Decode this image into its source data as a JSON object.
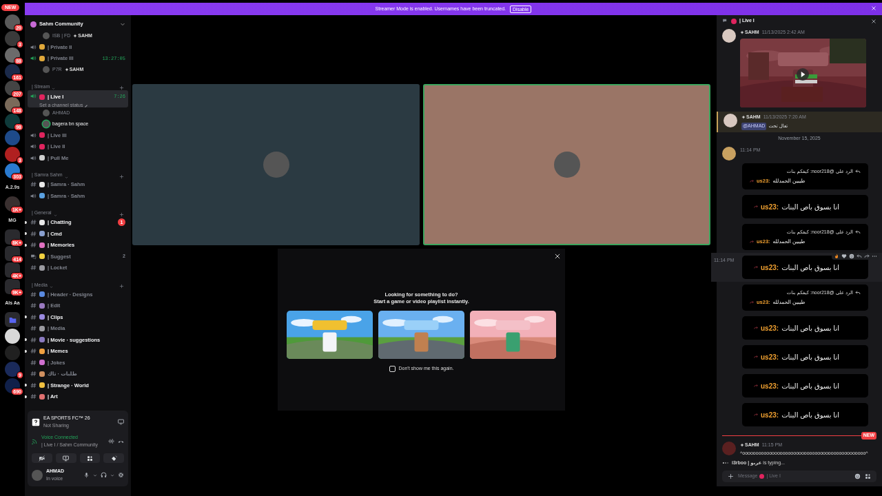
{
  "rail": {
    "new_badge": "NEW",
    "servers": [
      {
        "kind": "avatar",
        "color": "#5a5a5a",
        "badge": "20"
      },
      {
        "kind": "avatar",
        "color": "#3a3a3a",
        "badge": "3"
      },
      {
        "kind": "avatar",
        "color": "#6b6b6b",
        "badge": "88"
      },
      {
        "kind": "avatar",
        "color": "#1b2a4a",
        "badge": "161"
      },
      {
        "kind": "avatar",
        "color": "#444444",
        "badge": "207"
      },
      {
        "kind": "avatar",
        "color": "#7a6a5a",
        "badge": "148"
      },
      {
        "kind": "avatar",
        "color": "#0f3a3a",
        "badge": "98"
      },
      {
        "kind": "avatar",
        "color": "#1e4a8a"
      },
      {
        "kind": "avatar",
        "color": "#b02020",
        "badge": "3"
      },
      {
        "kind": "avatar",
        "color": "#2a7ad0",
        "badge": "303"
      },
      {
        "kind": "text",
        "label": "A.2.9s"
      },
      {
        "kind": "avatar",
        "color": "#3a3030",
        "badge": "1K+"
      },
      {
        "kind": "text",
        "label": "MG"
      },
      {
        "kind": "folder",
        "color": "#2a2a2e",
        "badge": "8K+"
      },
      {
        "kind": "folder",
        "color": "#2a2a2e",
        "badge": "414"
      },
      {
        "kind": "folder",
        "color": "#2a2a2e",
        "badge": "4K+"
      },
      {
        "kind": "folder",
        "color": "#2a2a2e",
        "badge": "9K+"
      },
      {
        "kind": "text",
        "label": "Als Aa"
      },
      {
        "kind": "open_folder",
        "color": "#5865f2"
      },
      {
        "kind": "avatar",
        "color": "#d8d8d8"
      },
      {
        "kind": "avatar",
        "color": "#202020"
      },
      {
        "kind": "avatar",
        "color": "#1a2a5a",
        "badge": "9"
      },
      {
        "kind": "avatar",
        "color": "#10204a",
        "badge": "690"
      }
    ]
  },
  "banner": {
    "text": "Streamer Mode is enabled. Usernames have been truncated.",
    "button": "Disable"
  },
  "server": {
    "name": "Sahm Community"
  },
  "channels": [
    {
      "kind": "member",
      "name": "ISB | FD",
      "tag": "SAHM",
      "speaking": false
    },
    {
      "kind": "voice",
      "name": "| Private II",
      "color": "#e0a83a",
      "active": false,
      "selected": false
    },
    {
      "kind": "voice",
      "name": "| Private III",
      "color": "#e0a83a",
      "active": true,
      "timer": "13:27:05",
      "selected": false
    },
    {
      "kind": "member",
      "name": "P7R",
      "tag": "SAHM",
      "speaking": false
    },
    {
      "kind": "category",
      "name": "| Stream"
    },
    {
      "kind": "voice",
      "name": "| Live I",
      "color": "#e0245e",
      "active": true,
      "timer": "7:26",
      "status": "Set a channel status",
      "selected": true
    },
    {
      "kind": "member",
      "name": "AHMAD",
      "speaking": false
    },
    {
      "kind": "member",
      "name": "bagera bn space",
      "speaking": true
    },
    {
      "kind": "voice",
      "name": "| Live III",
      "color": "#e0245e",
      "active": false,
      "selected": false
    },
    {
      "kind": "voice",
      "name": "| Live II",
      "color": "#e0245e",
      "active": false,
      "selected": false
    },
    {
      "kind": "voice",
      "name": "| Pull Me",
      "color": "#cfcfcf",
      "active": false,
      "selected": false
    },
    {
      "kind": "category",
      "name": "| Samra Sahm"
    },
    {
      "kind": "text",
      "name": "| Samra · Sahm",
      "color": "#e8e8e8",
      "unread": false
    },
    {
      "kind": "voice",
      "name": "| Samra · Sahm",
      "color": "#5aa0e0",
      "active": false,
      "selected": false
    },
    {
      "kind": "category",
      "name": "| General"
    },
    {
      "kind": "text",
      "name": "| Chatting",
      "color": "#e8e8e8",
      "unread": true,
      "mentions": "1"
    },
    {
      "kind": "text",
      "name": "| Cmd",
      "color": "#8aa0d0",
      "unread": true
    },
    {
      "kind": "text",
      "name": "| Memories",
      "color": "#e070c0",
      "unread": true
    },
    {
      "kind": "forum",
      "name": "| Suggest",
      "color": "#f0d040",
      "unread": false,
      "count": "2"
    },
    {
      "kind": "text",
      "name": "| Locket",
      "color": "#9a9aa0",
      "unread": false
    },
    {
      "kind": "category",
      "name": "| Media"
    },
    {
      "kind": "text",
      "name": "| Header · Designs",
      "color": "#5a8ae0",
      "unread": false
    },
    {
      "kind": "text",
      "name": "| Edit",
      "color": "#9a7ac0",
      "unread": false
    },
    {
      "kind": "text",
      "name": "| Clips",
      "color": "#9a8ae0",
      "unread": true
    },
    {
      "kind": "text",
      "name": "| Media",
      "color": "#9a9aa0",
      "unread": false
    },
    {
      "kind": "text",
      "name": "| Movie · suggestions",
      "color": "#8a7ac0",
      "unread": true
    },
    {
      "kind": "text",
      "name": "| Memes",
      "color": "#f0a040",
      "unread": true
    },
    {
      "kind": "text",
      "name": "| Jokes",
      "color": "#d070d0",
      "unread": false
    },
    {
      "kind": "text",
      "name": "طلبات · تاك",
      "color": "#d09060",
      "unread": false
    },
    {
      "kind": "text",
      "name": "| Strange · World",
      "color": "#f0c040",
      "unread": true
    },
    {
      "kind": "text",
      "name": "| Art",
      "color": "#e07070",
      "unread": true
    }
  ],
  "panel": {
    "game": "EA SPORTS FC™ 26",
    "sharing": "Not Sharing",
    "voice_title": "Voice Connected",
    "voice_location": "| Live I / Sahm Community",
    "user": "AHMAD",
    "user_status": "In voice"
  },
  "tiles": [
    {
      "color": "#2b3a42",
      "speaking": false
    },
    {
      "color": "#9a7566",
      "speaking": true
    }
  ],
  "activity": {
    "title": "Looking for something to do?",
    "subtitle": "Start a game or video playlist instantly.",
    "checkbox": {
      "label": "Don't show me this again.",
      "checked": false
    }
  },
  "chat": {
    "title": "| Live I",
    "messages": [
      {
        "kind": "embed",
        "tag": "SAHM",
        "time": "11/13/2025 2:42 AM"
      },
      {
        "kind": "mention",
        "tag": "SAHM",
        "time": "11/13/2025 7:20 AM",
        "mention": "@AHMAD",
        "text": "تعال تحت"
      },
      {
        "kind": "divider",
        "text": "November 15, 2025"
      },
      {
        "kind": "cards",
        "time": "11:14 PM",
        "cards": [
          {
            "kind": "reply",
            "reply": "الرد على @noor218: كيفكم بنات",
            "user": "us23:",
            "text": "طيبين الحمدلله",
            "hovered": false
          },
          {
            "kind": "single",
            "user": "us23:",
            "text": "انا بسوق باص البنات",
            "hovered": false
          },
          {
            "kind": "reply",
            "reply": "الرد على @noor218: كيفكم بنات",
            "user": "us23:",
            "text": "طيبين الحمدلله",
            "hovered": false
          },
          {
            "kind": "single",
            "user": "us23:",
            "text": "انا بسوق باص البنات",
            "hovered": true,
            "time": "11:14 PM"
          },
          {
            "kind": "reply",
            "reply": "الرد على @noor218: كيفكم بنات",
            "user": "us23:",
            "text": "طيبين الحمدلله",
            "hovered": false
          },
          {
            "kind": "single",
            "user": "us23:",
            "text": "انا بسوق باص البنات",
            "hovered": false
          },
          {
            "kind": "single",
            "user": "us23:",
            "text": "انا بسوق باص البنات",
            "hovered": false
          },
          {
            "kind": "single",
            "user": "us23:",
            "text": "انا بسوق باص البنات",
            "hovered": false
          },
          {
            "kind": "single",
            "user": "us23:",
            "text": "انا بسوق باص البنات",
            "hovered": false
          }
        ]
      }
    ],
    "new_label": "NEW",
    "last": {
      "tag": "SAHM",
      "time": "11:15 PM",
      "text": "^oooooooooooooooooooooooooooooooooooooooooooooo^"
    },
    "typing": "**i3rboo | عربو** is typing...",
    "composer": {
      "hint": "Message",
      "channel": "| Live I"
    }
  }
}
